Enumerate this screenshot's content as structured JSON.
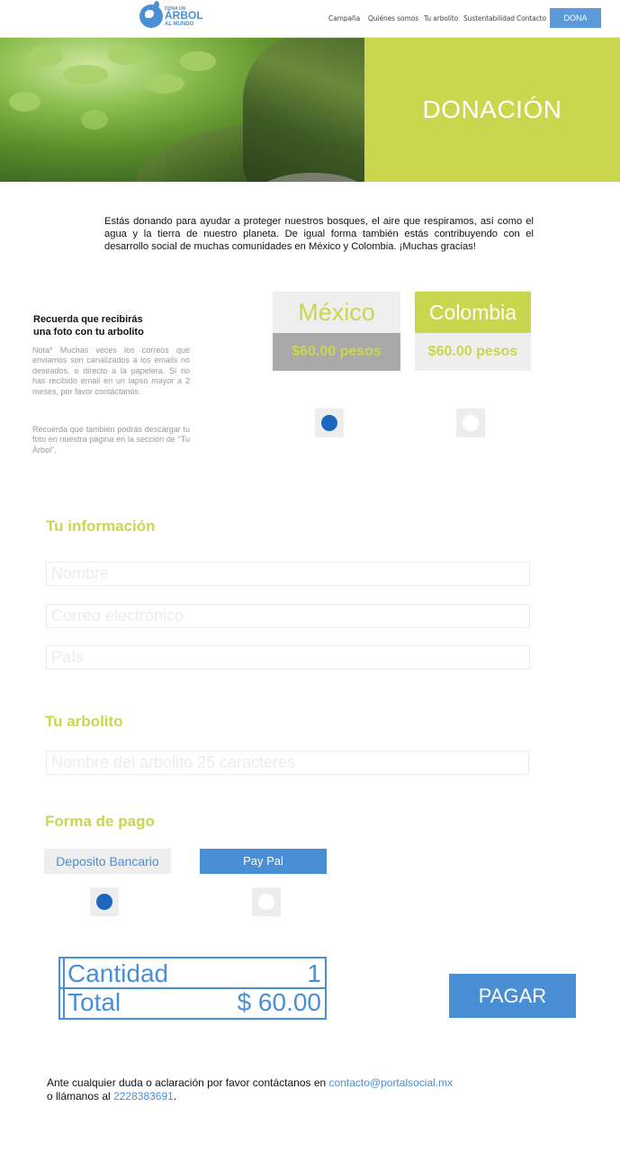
{
  "header": {
    "logo": {
      "line1": "DONA UN",
      "line2": "ÁRBOL",
      "line3": "AL MUNDO"
    },
    "nav": [
      "Campaña",
      "Quiénes somos",
      "Tu arbolito",
      "Sustentabilidad",
      "Contacto"
    ],
    "cta": "DONA"
  },
  "hero": {
    "title": "DONACIÓN"
  },
  "intro": "Estás donando para ayudar a proteger nuestros bosques, el aire que respiramos, así como el agua y la tierra de nuestro planeta. De igual forma también estás contribuyendo con el desarrollo social de muchas comunidades en México y Colombia. ¡Muchas gracias!",
  "note": {
    "title_line1": "Recuerda que recibirás",
    "title_line2": "una foto con tu arbolito",
    "body": "Nota* Muchas veces los correos que enviamos son canalizados a los emails no deseados, o directo a la papelera. Si no has recibido email en un lapso mayor a 2 meses, por favor contáctanos.",
    "body2": "Recuerda que también podrás descargar tu foto en nuestra página en la sección de \"Tu Árbol\"."
  },
  "countries": [
    {
      "name": "México",
      "price": "$60.00 pesos",
      "selected": true
    },
    {
      "name": "Colombia",
      "price": "$60.00 pesos",
      "selected": false
    }
  ],
  "info": {
    "title": "Tu información",
    "name_placeholder": "Nombre",
    "email_placeholder": "Correo electrónico",
    "country_placeholder": "País"
  },
  "tree": {
    "title": "Tu arbolito",
    "name_placeholder": "Nombre del arbolito 25 caractéres"
  },
  "payment": {
    "title": "Forma de pago",
    "options": [
      {
        "label": "Deposito Bancario",
        "selected": true
      },
      {
        "label": "Pay Pal",
        "selected": false
      }
    ]
  },
  "summary": {
    "quantity_label": "Cantidad",
    "quantity_value": "1",
    "total_label": "Total",
    "total_value": "$ 60.00"
  },
  "pay_button": "PAGAR",
  "footer": {
    "line1_text": "Ante cualquier duda o aclaración por favor contáctanos en",
    "email": "contacto@portalsocial.mx",
    "line2_text": "o llámanos al",
    "phone": "2228383691",
    "period": "."
  },
  "colors": {
    "accent_green": "#cad64e",
    "accent_blue": "#4a8fd6",
    "radio_blue": "#1b67bf"
  }
}
